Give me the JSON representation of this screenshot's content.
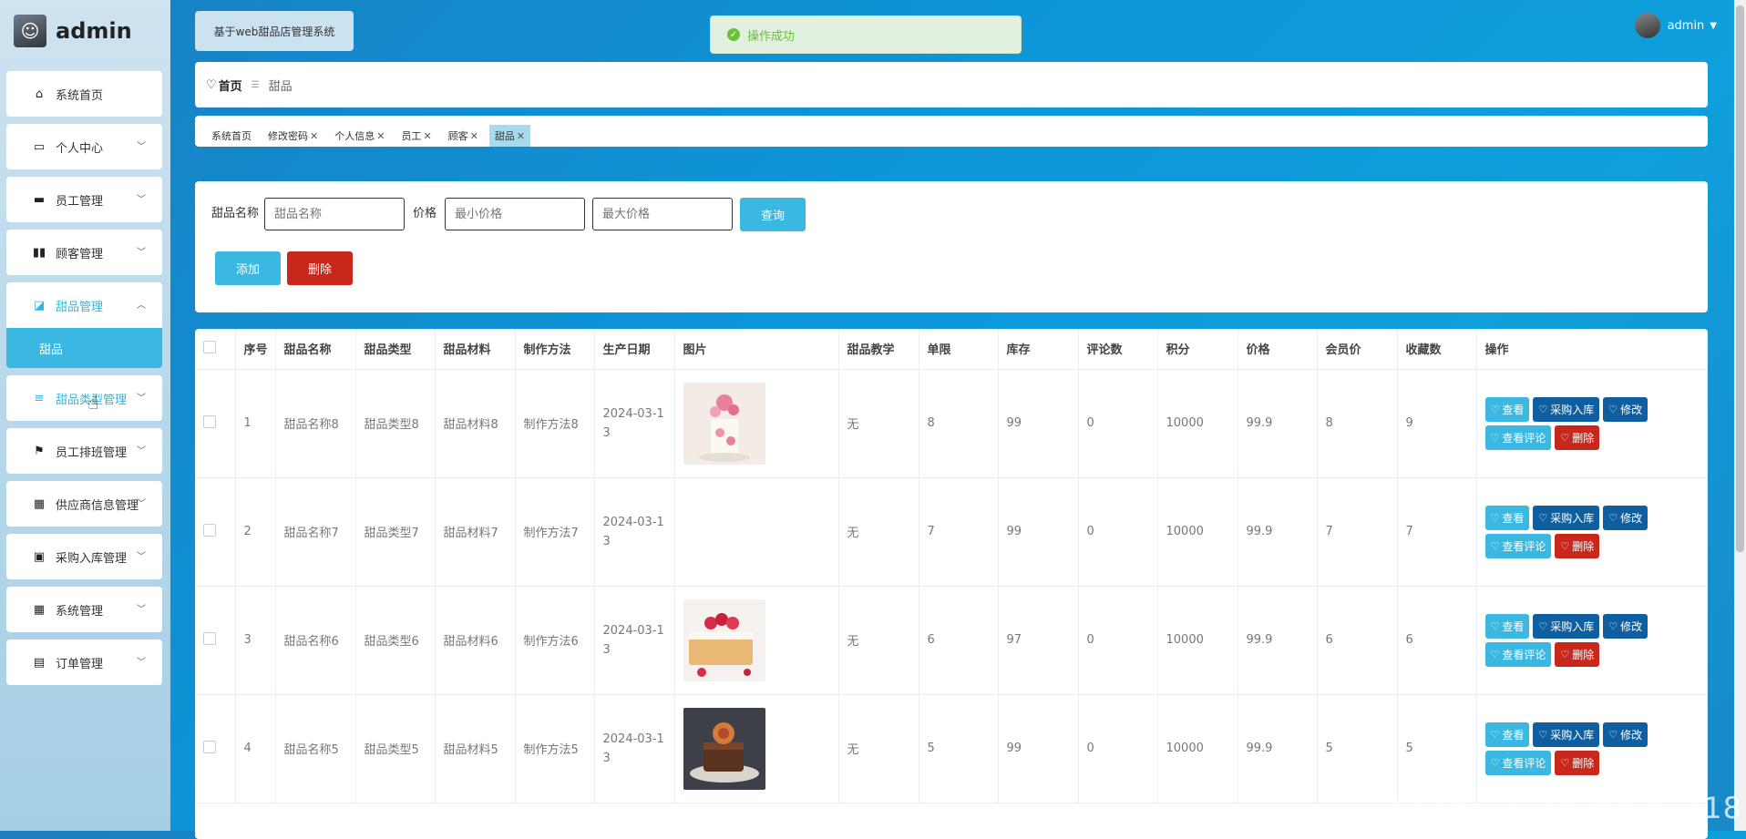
{
  "brand": {
    "title": "admin"
  },
  "header": {
    "system_title": "基于web甜品店管理系统",
    "toast": "操作成功",
    "user": "admin"
  },
  "sidebar": {
    "items": [
      {
        "label": "系统首页",
        "icon": "home-icon"
      },
      {
        "label": "个人中心",
        "icon": "card-icon"
      },
      {
        "label": "员工管理",
        "icon": "monitor-icon"
      },
      {
        "label": "顾客管理",
        "icon": "bars-icon"
      },
      {
        "label": "甜品管理",
        "icon": "chart-icon"
      },
      {
        "label": "甜品类型管理",
        "icon": "sliders-icon"
      },
      {
        "label": "员工排班管理",
        "icon": "flag-icon"
      },
      {
        "label": "供应商信息管理",
        "icon": "grid-icon"
      },
      {
        "label": "采购入库管理",
        "icon": "clipboard-check-icon"
      },
      {
        "label": "系统管理",
        "icon": "grid-icon"
      },
      {
        "label": "订单管理",
        "icon": "clipboard-icon"
      }
    ],
    "sub_item": "甜品"
  },
  "breadcrumb": {
    "home": "首页",
    "current": "甜品"
  },
  "tabs": [
    {
      "label": "系统首页",
      "closable": false
    },
    {
      "label": "修改密码",
      "closable": true
    },
    {
      "label": "个人信息",
      "closable": true
    },
    {
      "label": "员工",
      "closable": true
    },
    {
      "label": "顾客",
      "closable": true
    },
    {
      "label": "甜品",
      "closable": true
    }
  ],
  "search": {
    "name_label": "甜品名称",
    "name_placeholder": "甜品名称",
    "price_label": "价格",
    "min_placeholder": "最小价格",
    "max_placeholder": "最大价格",
    "query_button": "查询",
    "add_button": "添加",
    "delete_button": "删除"
  },
  "table": {
    "headers": [
      "序号",
      "甜品名称",
      "甜品类型",
      "甜品材料",
      "制作方法",
      "生产日期",
      "图片",
      "甜品教学",
      "单限",
      "库存",
      "评论数",
      "积分",
      "价格",
      "会员价",
      "收藏数",
      "操作"
    ],
    "rows": [
      {
        "idx": "1",
        "name": "甜品名称8",
        "type": "甜品类型8",
        "material": "甜品材料8",
        "method": "制作方法8",
        "date1": "2024-03-1",
        "date2": "3",
        "image": "cake-pink",
        "teach": "无",
        "limit": "8",
        "stock": "99",
        "comments": "0",
        "points": "10000",
        "price": "99.9",
        "member": "8",
        "fav": "9"
      },
      {
        "idx": "2",
        "name": "甜品名称7",
        "type": "甜品类型7",
        "material": "甜品材料7",
        "method": "制作方法7",
        "date1": "2024-03-1",
        "date2": "3",
        "image": "",
        "teach": "无",
        "limit": "7",
        "stock": "99",
        "comments": "0",
        "points": "10000",
        "price": "99.9",
        "member": "7",
        "fav": "7"
      },
      {
        "idx": "3",
        "name": "甜品名称6",
        "type": "甜品类型6",
        "material": "甜品材料6",
        "method": "制作方法6",
        "date1": "2024-03-1",
        "date2": "3",
        "image": "cake-raspberry",
        "teach": "无",
        "limit": "6",
        "stock": "97",
        "comments": "0",
        "points": "10000",
        "price": "99.9",
        "member": "6",
        "fav": "6"
      },
      {
        "idx": "4",
        "name": "甜品名称5",
        "type": "甜品类型5",
        "material": "甜品材料5",
        "method": "制作方法5",
        "date1": "2024-03-1",
        "date2": "3",
        "image": "cake-chocolate",
        "teach": "无",
        "limit": "5",
        "stock": "99",
        "comments": "0",
        "points": "10000",
        "price": "99.9",
        "member": "5",
        "fav": "5"
      }
    ],
    "ops": {
      "view": "查看",
      "purchase": "采购入库",
      "edit": "修改",
      "comments": "查看评论",
      "delete": "删除"
    }
  },
  "watermark": "CSDN @QQ849807118",
  "colors": {
    "accent": "#3ab8e2",
    "danger": "#c8281c",
    "dark_blue": "#0f5fa0",
    "success": "#67c23a"
  }
}
